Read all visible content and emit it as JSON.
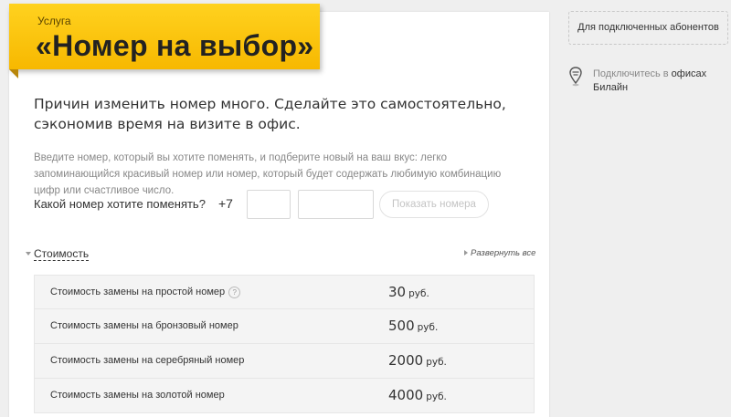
{
  "banner": {
    "eyebrow": "Услуга",
    "title": "«Номер на выбор»",
    "color": "#f9c51a"
  },
  "lead": "Причин изменить номер много. Сделайте это самостоятельно, сэкономив время на визите в офис.",
  "description": "Введите номер, который вы хотите поменять, и подберите новый на ваш вкус: легко запоминающийся красивый номер или номер, который будет содержать любимую комбинацию цифр или счастливое число.",
  "change_form": {
    "label": "Какой номер хотите поменять?",
    "prefix": "+7",
    "code_value": "",
    "number_value": "",
    "submit_label": "Показать номера"
  },
  "cost": {
    "title": "Стоимость",
    "expand_label": "Развернуть все",
    "rows": [
      {
        "name": "Стоимость замены на простой номер",
        "price": "30",
        "currency": "руб.",
        "has_help": true
      },
      {
        "name": "Стоимость замены на бронзовый номер",
        "price": "500",
        "currency": "руб.",
        "has_help": false
      },
      {
        "name": "Стоимость замены на серебряный номер",
        "price": "2000",
        "currency": "руб.",
        "has_help": false
      },
      {
        "name": "Стоимость замены на золотой номер",
        "price": "4000",
        "currency": "руб.",
        "has_help": false
      }
    ],
    "help_glyph": "?"
  },
  "sidebar": {
    "subscribers_label": "Для подключенных абонентов",
    "connect_prefix": "Подключитесь в ",
    "connect_link": "офисах Билайн",
    "pin_icon": "location-pin-icon"
  }
}
